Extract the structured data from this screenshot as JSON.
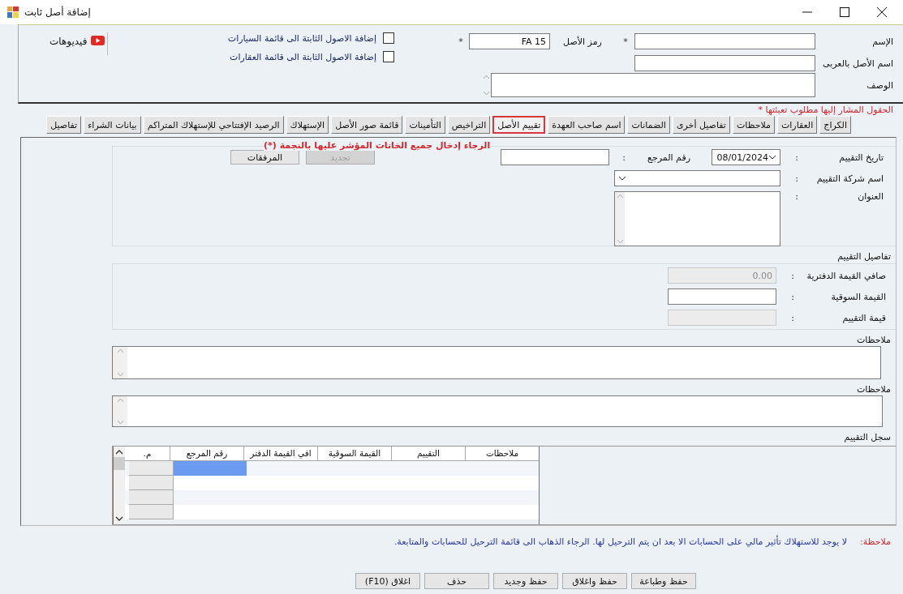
{
  "window": {
    "title": "إضافة أصل ثابت"
  },
  "header": {
    "name_label": "الإسم",
    "name_required": "*",
    "code_label": "رمز الأصل",
    "code_value": "FA 15",
    "code_required": "*",
    "arabic_name_label": "اسم الأصل بالعربى",
    "description_label": "الوصف",
    "checkboxes": [
      {
        "label": "إضافة الاصول الثابتة الى قائمة السيارات",
        "checked": false
      },
      {
        "label": "إضافة الاصول الثابتة الى قائمة العقارات",
        "checked": false
      }
    ],
    "videos_link": "فيديوهات"
  },
  "required_note": "الحقول المشار إليها مطلوب تعبئتها *",
  "tabs": [
    {
      "label": "الكراج",
      "selected": false
    },
    {
      "label": "العقارات",
      "selected": false
    },
    {
      "label": "ملاحظات",
      "selected": false
    },
    {
      "label": "تفاصيل أخرى",
      "selected": false
    },
    {
      "label": "الضمانات",
      "selected": false
    },
    {
      "label": "اسم صاحب العهدة",
      "selected": false
    },
    {
      "label": "تقييم الأصل",
      "selected": true
    },
    {
      "label": "التراخيص",
      "selected": false
    },
    {
      "label": "التأمينات",
      "selected": false
    },
    {
      "label": "قائمة صور الأصل",
      "selected": false
    },
    {
      "label": "الإستهلاك",
      "selected": false
    },
    {
      "label": "الرصيد الإفتتاحي للإستهلاك المتراكم",
      "selected": false
    },
    {
      "label": "بيانات الشراء",
      "selected": false
    },
    {
      "label": "تفاصيل",
      "selected": false
    }
  ],
  "valuation": {
    "warning": "الرجاء إدخال جميع الخانات المؤشر عليها بالنجمة (*)",
    "date": {
      "label": "تاريخ التقييم",
      "colon": ":",
      "value": "08/01/2024"
    },
    "reference": {
      "label": "رقم المرجع",
      "colon": ":"
    },
    "company": {
      "label": "اسم شركة التقييم",
      "colon": ":"
    },
    "address": {
      "label": "العنوان",
      "colon": ":"
    },
    "buttons": [
      {
        "label": "تجديد",
        "disabled": true
      },
      {
        "label": "المرفقات",
        "disabled": false
      }
    ]
  },
  "details": {
    "title": "تفاصيل التقييم",
    "fields": [
      {
        "label": "صافي القيمة الدفترية",
        "colon": ":",
        "value": "0.00",
        "disabled": true
      },
      {
        "label": "القيمة السوقية",
        "colon": ":",
        "disabled": false
      },
      {
        "label": "قيمة التقييم",
        "colon": ":",
        "disabled": true
      }
    ]
  },
  "notes": [
    {
      "label": "ملاحظات"
    },
    {
      "label": "ملاحظات"
    }
  ],
  "history": {
    "title": "سجل التقييم",
    "columns": [
      "ملاحظات",
      "التقييم",
      "القيمة السوقية",
      "افي القيمة الدفتر",
      "رقم المرجع",
      "م."
    ],
    "rows": [
      {
        "selected": true
      },
      {
        "selected": false
      },
      {
        "selected": false
      },
      {
        "selected": false
      }
    ]
  },
  "footer_note": {
    "label": "ملاحظة:",
    "text": "لا يوجد للاستهلاك تأثير مالي على الحسابات الا بعد ان يتم الترحيل لها. الرجاء الذهاب الى قائمة الترحيل للحسابات والمتابعة."
  },
  "actions": [
    "حفظ وطباعة",
    "حفظ واغلاق",
    "حفظ وجديد",
    "حذف",
    "اغلاق (F10)"
  ]
}
